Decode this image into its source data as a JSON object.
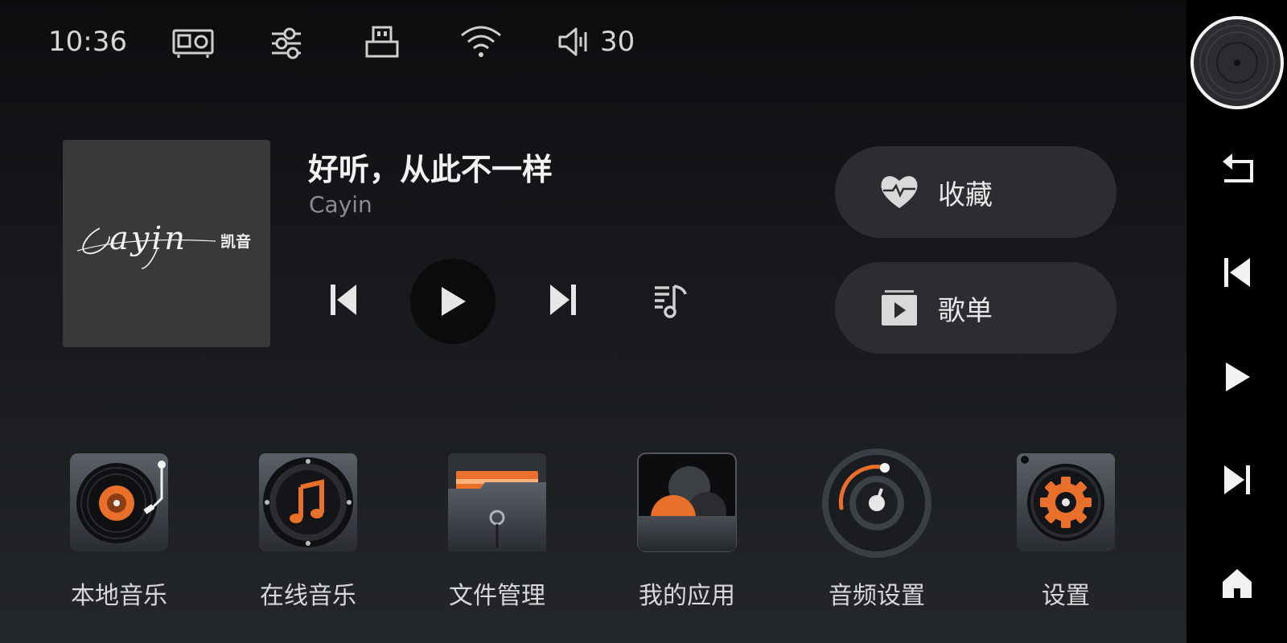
{
  "status_bar": {
    "time": "10:36",
    "icons": [
      "projector-icon",
      "equalizer-sliders-icon",
      "usb-icon",
      "wifi-icon",
      "volume-icon"
    ],
    "volume": "30"
  },
  "now_playing": {
    "title": "好听，从此不一样",
    "artist": "Cayin",
    "album_art_logo": "Cayin 凯音"
  },
  "controls": {
    "prev": "skip-previous-icon",
    "play": "play-icon",
    "next": "skip-next-icon",
    "queue": "playlist-icon"
  },
  "quick_actions": [
    {
      "label": "收藏",
      "icon": "heart-icon"
    },
    {
      "label": "歌单",
      "icon": "playlist-play-icon"
    }
  ],
  "apps": [
    {
      "label": "本地音乐",
      "icon": "turntable-icon"
    },
    {
      "label": "在线音乐",
      "icon": "music-note-disc-icon"
    },
    {
      "label": "文件管理",
      "icon": "folder-icon"
    },
    {
      "label": "我的应用",
      "icon": "apps-icon"
    },
    {
      "label": "音频设置",
      "icon": "dial-icon"
    },
    {
      "label": "设置",
      "icon": "gear-icon"
    }
  ],
  "sidebar": {
    "buttons": [
      "vinyl-disc-icon",
      "back-icon",
      "skip-previous-icon",
      "play-icon",
      "skip-next-icon",
      "home-icon"
    ]
  },
  "colors": {
    "accent": "#e8702a",
    "background": "#1a1c1f",
    "pill": "#2b2d31"
  }
}
